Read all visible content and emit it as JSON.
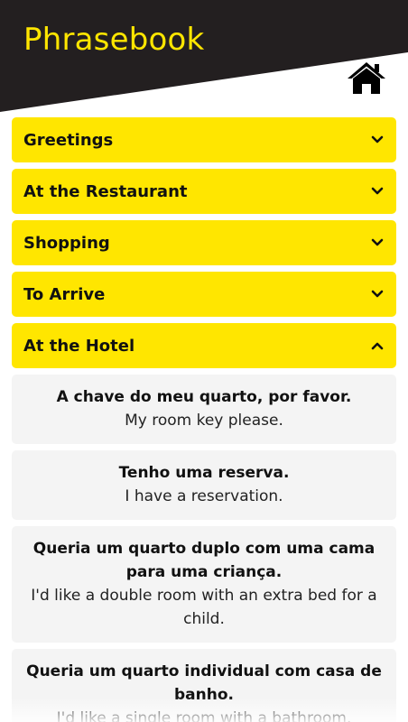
{
  "header": {
    "title": "Phrasebook",
    "home_icon": "home-icon",
    "colors": {
      "background": "#231f20",
      "accent": "#ffe600"
    }
  },
  "categories": [
    {
      "label": "Greetings",
      "expanded": false
    },
    {
      "label": "At the Restaurant",
      "expanded": false
    },
    {
      "label": "Shopping",
      "expanded": false
    },
    {
      "label": "To Arrive",
      "expanded": false
    },
    {
      "label": "At the Hotel",
      "expanded": true
    }
  ],
  "phrases": [
    {
      "pt": "A chave do meu quarto, por favor.",
      "en": "My room key please."
    },
    {
      "pt": "Tenho uma reserva.",
      "en": "I have a reservation."
    },
    {
      "pt": "Queria um quarto duplo com uma cama para uma criança.",
      "en": "I'd like a double room with an extra bed for a child."
    },
    {
      "pt": "Queria um quarto individual com casa de banho.",
      "en": "I'd like a single room with a bathroom."
    }
  ]
}
